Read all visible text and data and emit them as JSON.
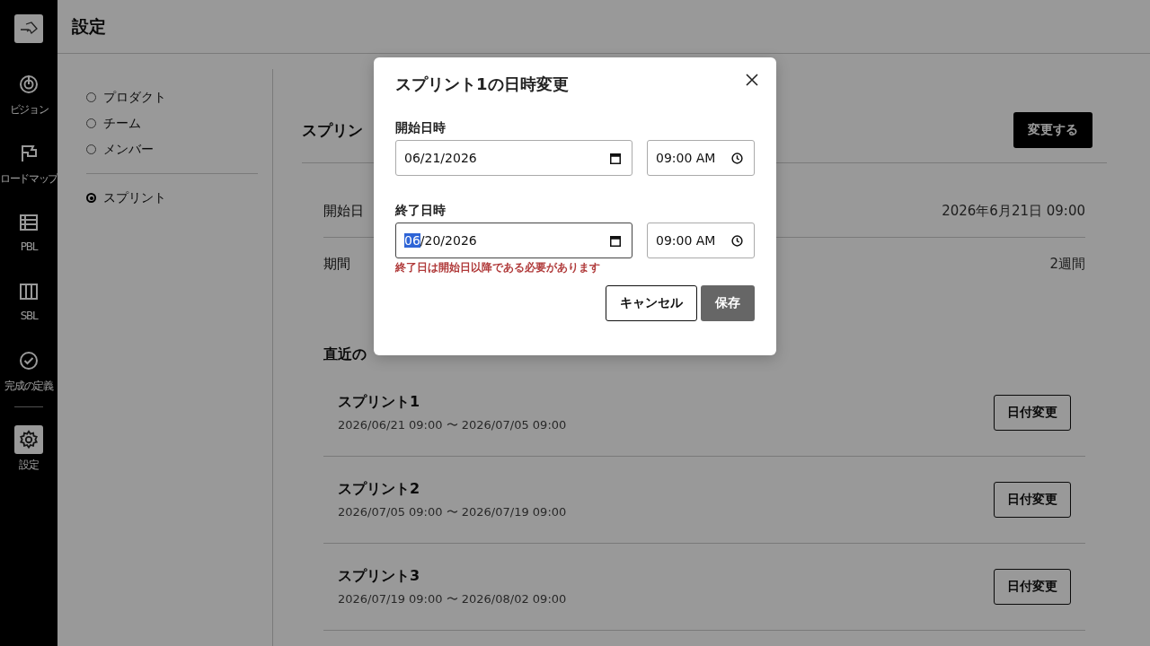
{
  "sidebar": {
    "items": [
      {
        "label": "ビジョン",
        "selected": false
      },
      {
        "label": "ロードマップ",
        "selected": false
      },
      {
        "label": "PBL",
        "selected": false
      },
      {
        "label": "SBL",
        "selected": false
      },
      {
        "label": "完成の定義",
        "selected": false
      },
      {
        "label": "設定",
        "selected": true
      }
    ]
  },
  "header": {
    "title": "設定"
  },
  "settings_nav": {
    "items": [
      {
        "label": "プロダクト",
        "selected": false
      },
      {
        "label": "チーム",
        "selected": false
      },
      {
        "label": "メンバー",
        "selected": false
      },
      {
        "label": "スプリント",
        "selected": true
      }
    ]
  },
  "sprint_settings": {
    "heading": "スプリン",
    "change_button": "変更する",
    "fields": [
      {
        "label": "開始日",
        "value": "2026年6月21日 09:00"
      },
      {
        "label": "期間",
        "value": "2週間"
      }
    ],
    "recent_heading": "直近の",
    "recent": [
      {
        "name": "スプリント1",
        "range": "2026/06/21 09:00 〜 2026/07/05 09:00",
        "button": "日付変更"
      },
      {
        "name": "スプリント2",
        "range": "2026/07/05 09:00 〜 2026/07/19 09:00",
        "button": "日付変更"
      },
      {
        "name": "スプリント3",
        "range": "2026/07/19 09:00 〜 2026/08/02 09:00",
        "button": "日付変更"
      }
    ]
  },
  "dialog": {
    "title": "スプリント1の日時変更",
    "groups": [
      {
        "label": "開始日時",
        "date": "06/21/2026",
        "time": "09:00 AM",
        "focused": false
      },
      {
        "label": "終了日時",
        "date": "06/20/2026",
        "time": "09:00 AM",
        "focused": true,
        "error": "終了日は開始日以降である必要があります"
      }
    ],
    "cancel": "キャンセル",
    "save": "保存",
    "save_disabled": true
  }
}
